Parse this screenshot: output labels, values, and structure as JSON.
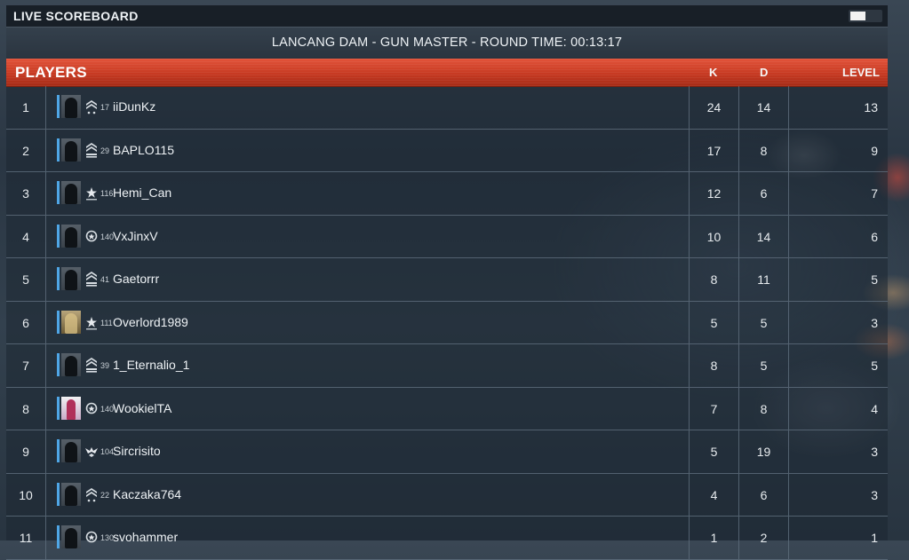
{
  "window": {
    "title": "LIVE SCOREBOARD"
  },
  "map_info": "LANCANG DAM - GUN MASTER - ROUND TIME: 00:13:17",
  "table": {
    "title": "PLAYERS",
    "columns": {
      "k": "K",
      "d": "D",
      "level": "LEVEL"
    },
    "rows": [
      {
        "rank": "1",
        "rank_level": "17",
        "rank_icon": "chevrons-icon",
        "avatar": "soldier",
        "name": "iiDunKz",
        "k": "24",
        "d": "14",
        "level": "13"
      },
      {
        "rank": "2",
        "rank_level": "29",
        "rank_icon": "chevrons-bars-icon",
        "avatar": "soldier",
        "name": "BAPLO115",
        "k": "17",
        "d": "8",
        "level": "9"
      },
      {
        "rank": "3",
        "rank_level": "116",
        "rank_icon": "star-icon",
        "avatar": "soldier",
        "name": "Hemi_Can",
        "k": "12",
        "d": "6",
        "level": "7"
      },
      {
        "rank": "4",
        "rank_level": "140",
        "rank_icon": "wreath-icon",
        "avatar": "soldier",
        "name": "VxJinxV",
        "k": "10",
        "d": "14",
        "level": "6"
      },
      {
        "rank": "5",
        "rank_level": "41",
        "rank_icon": "chevrons-bars-icon",
        "avatar": "soldier",
        "name": "Gaetorrr",
        "k": "8",
        "d": "11",
        "level": "5"
      },
      {
        "rank": "6",
        "rank_level": "111",
        "rank_icon": "star-icon",
        "avatar": "gold",
        "name": "Overlord1989",
        "k": "5",
        "d": "5",
        "level": "3"
      },
      {
        "rank": "7",
        "rank_level": "39",
        "rank_icon": "chevrons-bars-icon",
        "avatar": "soldier",
        "name": "1_Eternalio_1",
        "k": "8",
        "d": "5",
        "level": "5"
      },
      {
        "rank": "8",
        "rank_level": "140",
        "rank_icon": "wreath-icon",
        "avatar": "portrait",
        "name": "WookielTA",
        "k": "7",
        "d": "8",
        "level": "4"
      },
      {
        "rank": "9",
        "rank_level": "104",
        "rank_icon": "eagle-icon",
        "avatar": "soldier",
        "name": "Sircrisito",
        "k": "5",
        "d": "19",
        "level": "3"
      },
      {
        "rank": "10",
        "rank_level": "22",
        "rank_icon": "chevrons-icon",
        "avatar": "soldier",
        "name": "Kaczaka764",
        "k": "4",
        "d": "6",
        "level": "3"
      },
      {
        "rank": "11",
        "rank_level": "130",
        "rank_icon": "wreath-icon",
        "avatar": "soldier",
        "name": "svohammer",
        "k": "1",
        "d": "2",
        "level": "1"
      }
    ]
  },
  "colors": {
    "header_red": "#c73a22",
    "squad_blue": "#4fa6e6",
    "background": "#2a3643"
  }
}
